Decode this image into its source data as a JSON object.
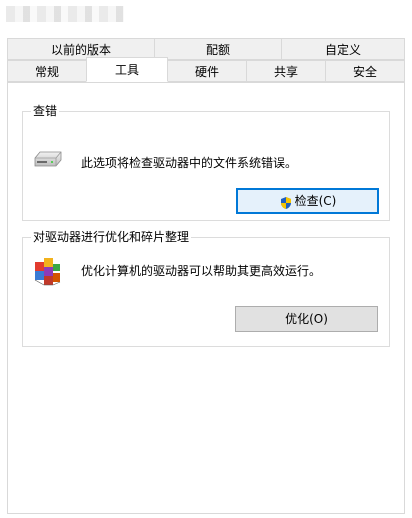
{
  "window": {
    "title_obscured": true
  },
  "tabs_row_top": [
    "以前的版本",
    "配额",
    "自定义"
  ],
  "tabs_row_bottom": [
    "常规",
    "工具",
    "硬件",
    "共享",
    "安全"
  ],
  "active_tab": "工具",
  "groups": {
    "error_check": {
      "title": "查错",
      "description": "此选项将检查驱动器中的文件系统错误。",
      "button_label": "检查(C)",
      "icon": "drive-icon",
      "button_icon": "uac-shield-icon"
    },
    "optimize": {
      "title": "对驱动器进行优化和碎片整理",
      "description": "优化计算机的驱动器可以帮助其更高效运行。",
      "button_label": "优化(O)",
      "icon": "defrag-icon"
    }
  }
}
